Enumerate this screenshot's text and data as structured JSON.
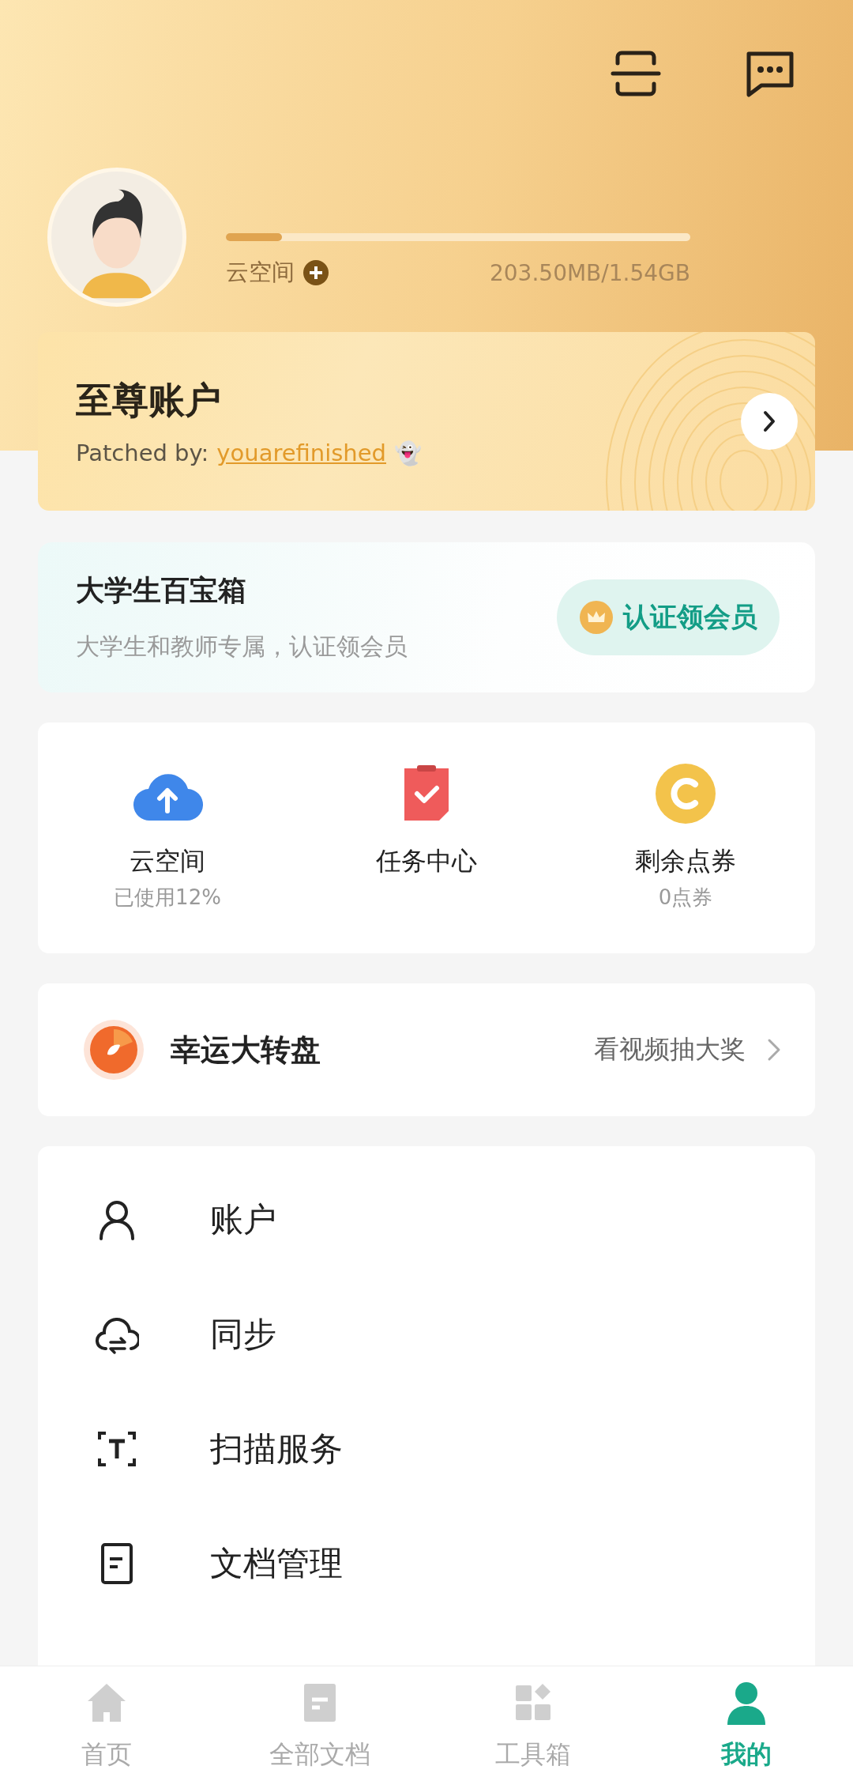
{
  "header": {
    "storage": {
      "label": "云空间",
      "level": 0.12,
      "usage": "203.50MB/1.54GB"
    }
  },
  "premium_card": {
    "title": "至尊账户",
    "patched_by": "Patched by:",
    "link": "youarefinished",
    "emoji": "👻"
  },
  "student_card": {
    "title": "大学生百宝箱",
    "subtitle": "大学生和教师专属，认证领会员",
    "button": "认证领会员"
  },
  "stats": [
    {
      "kind": "cloud",
      "label": "云空间",
      "sub": "已使用12%"
    },
    {
      "kind": "task",
      "label": "任务中心"
    },
    {
      "kind": "coupon",
      "label": "剩余点券",
      "sub": "0点券"
    }
  ],
  "lucky_wheel": {
    "title": "幸运大转盘",
    "action": "看视频抽大奖"
  },
  "menu": [
    {
      "kind": "account",
      "label": "账户"
    },
    {
      "kind": "sync",
      "label": "同步"
    },
    {
      "kind": "scan",
      "label": "扫描服务"
    },
    {
      "kind": "docs",
      "label": "文档管理"
    }
  ],
  "tabs": [
    {
      "kind": "home",
      "label": "首页",
      "selected": false
    },
    {
      "kind": "docs",
      "label": "全部文档",
      "selected": false
    },
    {
      "kind": "tools",
      "label": "工具箱",
      "selected": false
    },
    {
      "kind": "me",
      "label": "我的",
      "selected": true
    }
  ]
}
